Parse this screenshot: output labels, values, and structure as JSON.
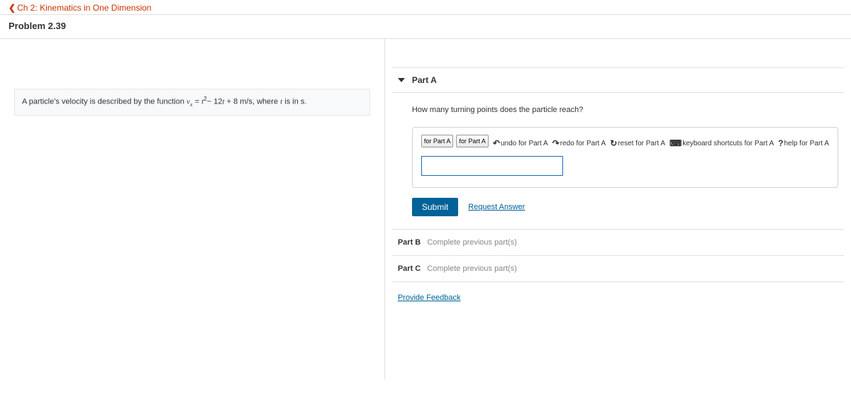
{
  "nav": {
    "breadcrumb": "Ch 2: Kinematics in One Dimension"
  },
  "header": {
    "title": "Problem 2.39"
  },
  "prompt": {
    "pre": "A particle's velocity is described by the function ",
    "var_v": "v",
    "sub_x": "x",
    "eq": " = ",
    "var_t": "t",
    "sq": "2",
    "mid": "− 12",
    "plus": " + 8 m/s",
    "post": ", where ",
    "unit": " is in s."
  },
  "partA": {
    "label": "Part A",
    "question": "How many turning points does the particle reach?",
    "toolbar": {
      "btn1": "for Part A",
      "btn2": "for Part A",
      "undo": "undo for Part A",
      "redo": "redo for Part A",
      "reset": "reset for Part A",
      "shortcuts": "keyboard shortcuts for Part A",
      "help": "help for Part A"
    },
    "submit": "Submit",
    "request": "Request Answer"
  },
  "partB": {
    "label": "Part B",
    "msg": "Complete previous part(s)"
  },
  "partC": {
    "label": "Part C",
    "msg": "Complete previous part(s)"
  },
  "feedback": "Provide Feedback"
}
